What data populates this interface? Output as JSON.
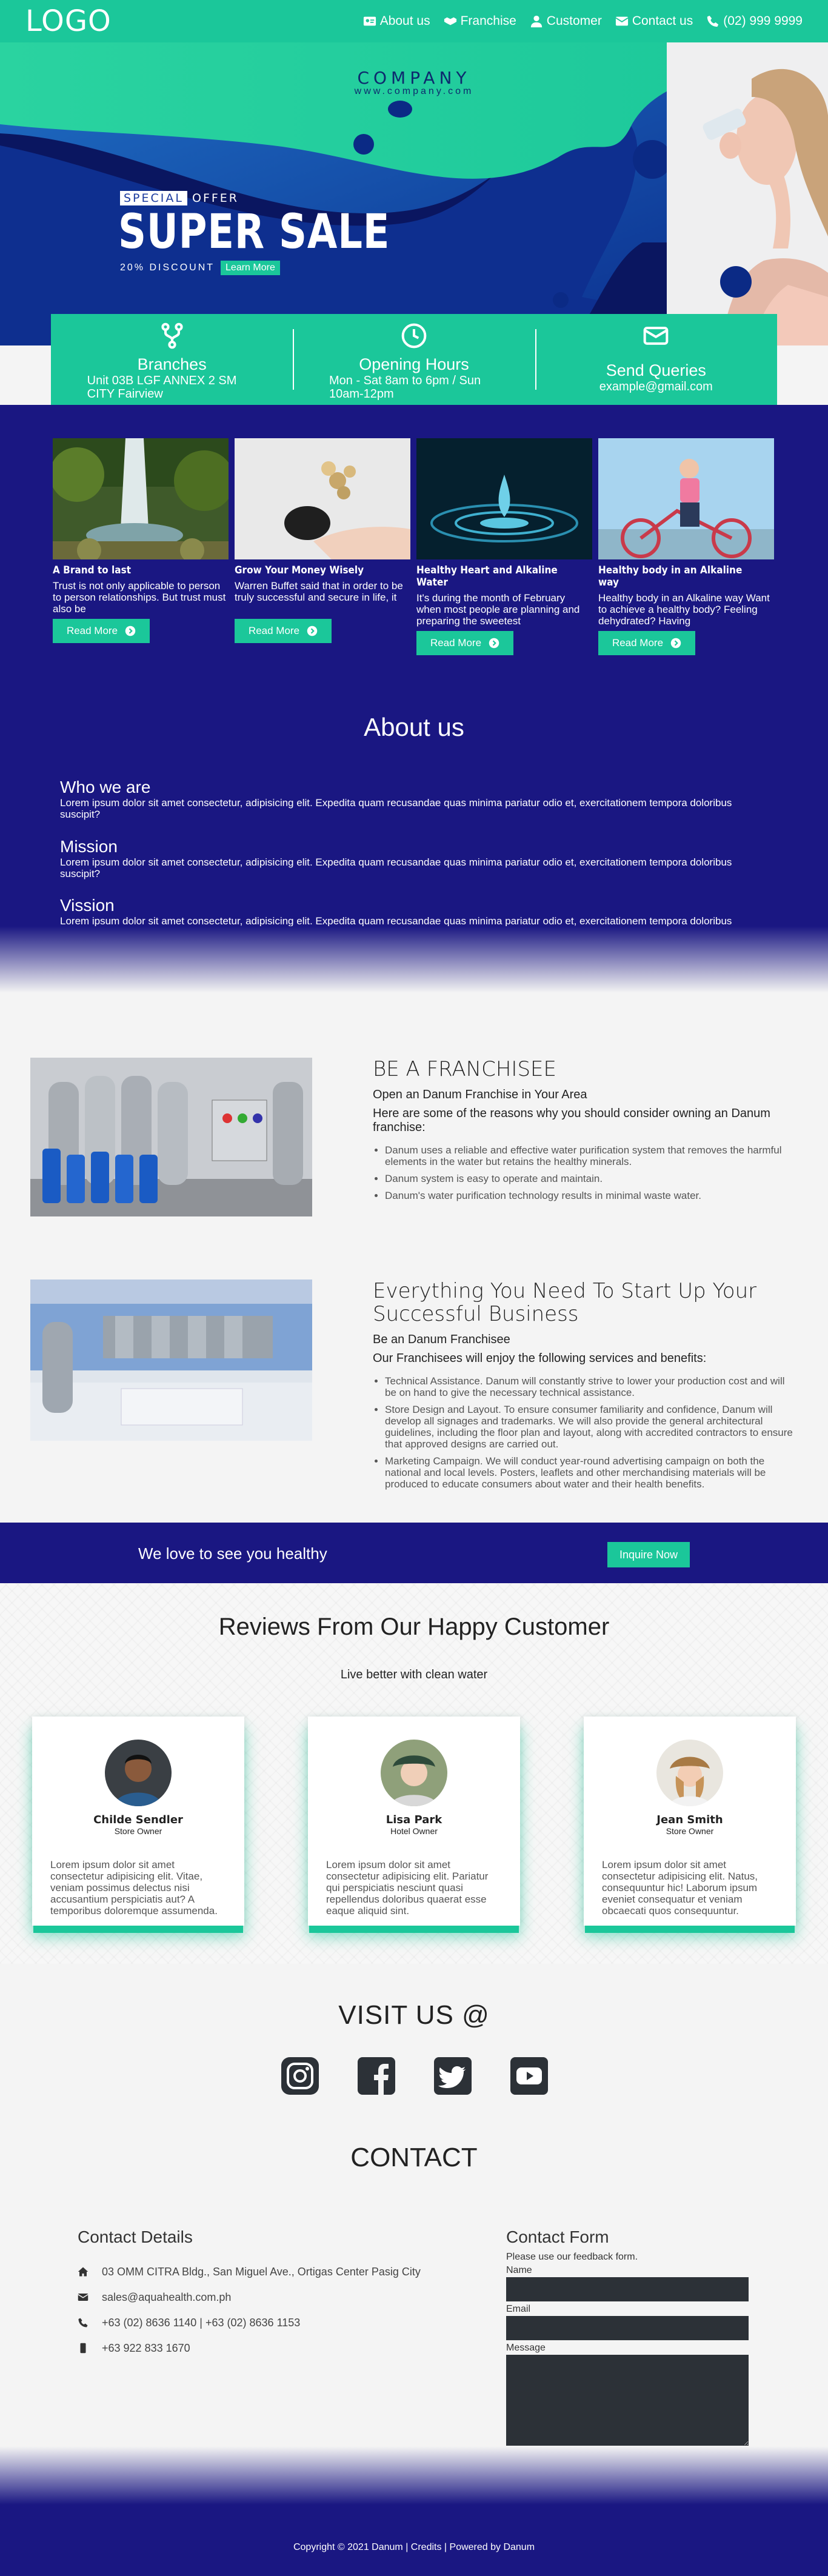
{
  "nav": {
    "logo": "LOGO",
    "links": [
      {
        "label": "About us",
        "icon": "id-card-icon"
      },
      {
        "label": "Franchise",
        "icon": "handshake-icon"
      },
      {
        "label": "Customer",
        "icon": "user-icon"
      },
      {
        "label": "Contact us",
        "icon": "envelope-icon"
      },
      {
        "label": "(02) 999 9999",
        "icon": "phone-icon"
      }
    ]
  },
  "hero": {
    "company": "COMPANY",
    "website": "www.company.com",
    "special": "SPECIAL",
    "offer": "OFFER",
    "super_sale": "SUPER SALE",
    "discount": "20% DISCOUNT",
    "learn_more": "Learn More"
  },
  "info": [
    {
      "title": "Branches",
      "text": "Unit 03B LGF ANNEX 2 SM CITY Fairview",
      "icon": "branch-icon"
    },
    {
      "title": "Opening Hours",
      "text": "Mon - Sat 8am to 6pm / Sun 10am-12pm",
      "icon": "clock-icon"
    },
    {
      "title": "Send Queries",
      "text": "example@gmail.com",
      "icon": "mail-icon"
    }
  ],
  "cards": [
    {
      "title": "A Brand to last",
      "text": "Trust is not only applicable to person to person relationships. But trust must also be",
      "button": "Read More"
    },
    {
      "title": "Grow Your Money Wisely",
      "text": "Warren Buffet said that in order to be truly successful and secure in life, it",
      "button": "Read More"
    },
    {
      "title": "Healthy Heart and Alkaline Water",
      "text": "It's during the month of February when most people are planning and preparing the sweetest",
      "button": "Read More"
    },
    {
      "title": "Healthy body in an Alkaline way",
      "text": "Healthy body in an Alkaline way Want to achieve a healthy body? Feeling dehydrated? Having",
      "button": "Read More"
    }
  ],
  "about": {
    "title": "About us",
    "items": [
      {
        "heading": "Who we are",
        "text": "Lorem ipsum dolor sit amet consectetur, adipisicing elit. Expedita quam recusandae quas minima pariatur odio et, exercitationem tempora doloribus suscipit?"
      },
      {
        "heading": "Mission",
        "text": "Lorem ipsum dolor sit amet consectetur, adipisicing elit. Expedita quam recusandae quas minima pariatur odio et, exercitationem tempora doloribus suscipit?"
      },
      {
        "heading": "Vission",
        "text": "Lorem ipsum dolor sit amet consectetur, adipisicing elit. Expedita quam recusandae quas minima pariatur odio et, exercitationem tempora doloribus suscipit?"
      }
    ]
  },
  "franchise1": {
    "title": "BE A FRANCHISEE",
    "subtitle": "Open an Danum Franchise in Your Area",
    "lead": "Here are some of the reasons why you should consider owning an Danum franchise:",
    "bullets": [
      "Danum uses a reliable and effective water purification system that removes the harmful elements in the water but retains the healthy minerals.",
      "Danum system is easy to operate and maintain.",
      "Danum's water purification technology results in minimal waste water."
    ]
  },
  "franchise2": {
    "title": "Everything You Need To Start Up Your Successful Business",
    "subtitle": "Be an Danum Franchisee",
    "lead": "Our Franchisees will enjoy the following services and benefits:",
    "bullets": [
      "Technical Assistance. Danum will constantly strive to lower your production cost and will be on hand to give the necessary technical assistance.",
      "Store Design and Layout. To ensure consumer familiarity and confidence, Danum will develop all signages and trademarks. We will also provide the general architectural guidelines, including the floor plan and layout, along with accredited contractors to ensure that approved designs are carried out.",
      "Marketing Campaign. We will conduct year-round advertising campaign on both the national and local levels. Posters, leaflets and other merchandising materials will be produced to educate consumers about water and their health benefits."
    ]
  },
  "band": {
    "text": "We love to see you healthy",
    "button": "Inquire Now"
  },
  "reviews": {
    "title": "Reviews From Our Happy Customer",
    "subtitle": "Live better with clean water",
    "items": [
      {
        "name": "Childe Sendler",
        "role": "Store Owner",
        "text": "Lorem ipsum dolor sit amet consectetur adipisicing elit. Vitae, veniam possimus delectus nisi accusantium perspiciatis aut? A temporibus doloremque assumenda."
      },
      {
        "name": "Lisa Park",
        "role": "Hotel Owner",
        "text": "Lorem ipsum dolor sit amet consectetur adipisicing elit. Pariatur qui perspiciatis nesciunt quasi repellendus doloribus quaerat esse eaque aliquid sint."
      },
      {
        "name": "Jean Smith",
        "role": "Store Owner",
        "text": "Lorem ipsum dolor sit amet consectetur adipisicing elit. Natus, consequuntur hic! Laborum ipsum eveniet consequatur et veniam obcaecati quos consequuntur."
      }
    ]
  },
  "visit": {
    "title": "VISIT US @",
    "icons": [
      "instagram-icon",
      "facebook-icon",
      "twitter-icon",
      "youtube-icon"
    ]
  },
  "contact": {
    "title": "CONTACT",
    "details_title": "Contact Details",
    "details": [
      {
        "icon": "home-icon",
        "text": "03 OMM CITRA Bldg., San Miguel Ave., Ortigas Center Pasig City"
      },
      {
        "icon": "envelope-icon",
        "text": "sales@aquahealth.com.ph"
      },
      {
        "icon": "phone-icon",
        "text": "+63 (02) 8636 1140 | +63 (02) 8636 1153"
      },
      {
        "icon": "mobile-icon",
        "text": "+63 922 833 1670"
      }
    ],
    "form_title": "Contact Form",
    "form_note": "Please use our feedback form.",
    "labels": {
      "name": "Name",
      "email": "Email",
      "message": "Message"
    }
  },
  "footer": {
    "copyright": "Copyright © 2021 Danum | Credits | Powered by Danum"
  },
  "colors": {
    "accent": "#1bc79a",
    "navy": "#1a1782",
    "hero_blue": "#0d1b7e"
  }
}
